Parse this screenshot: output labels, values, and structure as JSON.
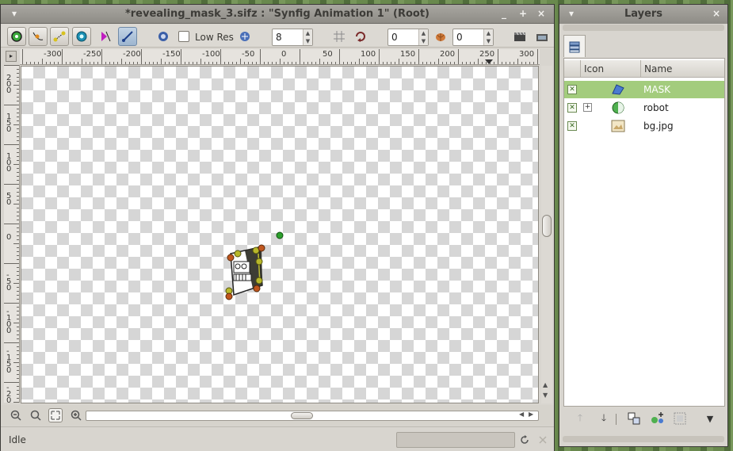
{
  "canvas_window": {
    "title": "*revealing_mask_3.sifz : \"Synfig Animation 1\" (Root)",
    "controls": {
      "menu": "▾",
      "minimize": "_",
      "maximize": "+",
      "close": "×"
    },
    "toolbar": {
      "low_res_label": "Low Res",
      "low_res_checked": false,
      "resolution_value": "8",
      "onion_past_value": "0",
      "onion_future_value": "0"
    },
    "ruler_h_labels": [
      "-300",
      "-250",
      "-200",
      "-150",
      "-100",
      "-50",
      "0",
      "50",
      "100",
      "150",
      "200",
      "250",
      "300"
    ],
    "ruler_v_labels": [
      "2\n0\n0",
      "1\n5\n0",
      "1\n0\n0",
      "5\n0",
      "0",
      "-\n5\n0",
      "-\n1\n0\n0",
      "-\n1\n5\n0",
      "-\n2\n0\n0"
    ],
    "status": "Idle"
  },
  "layers_panel": {
    "title": "Layers",
    "controls": {
      "menu": "▾",
      "close": "×"
    },
    "columns": {
      "icon": "Icon",
      "name": "Name"
    },
    "layers": [
      {
        "name": "MASK",
        "visible": true,
        "selected": true,
        "icon": "polygon-icon",
        "expandable": false
      },
      {
        "name": "robot",
        "visible": true,
        "selected": false,
        "icon": "group-icon",
        "expandable": true,
        "expander": "+"
      },
      {
        "name": "bg.jpg",
        "visible": true,
        "selected": false,
        "icon": "image-icon",
        "expandable": false
      }
    ]
  },
  "colors": {
    "selected_row": "#a3cc7d",
    "handle_green": "#2da02d",
    "handle_olive": "#b8b82a",
    "handle_orange": "#c0561e"
  }
}
